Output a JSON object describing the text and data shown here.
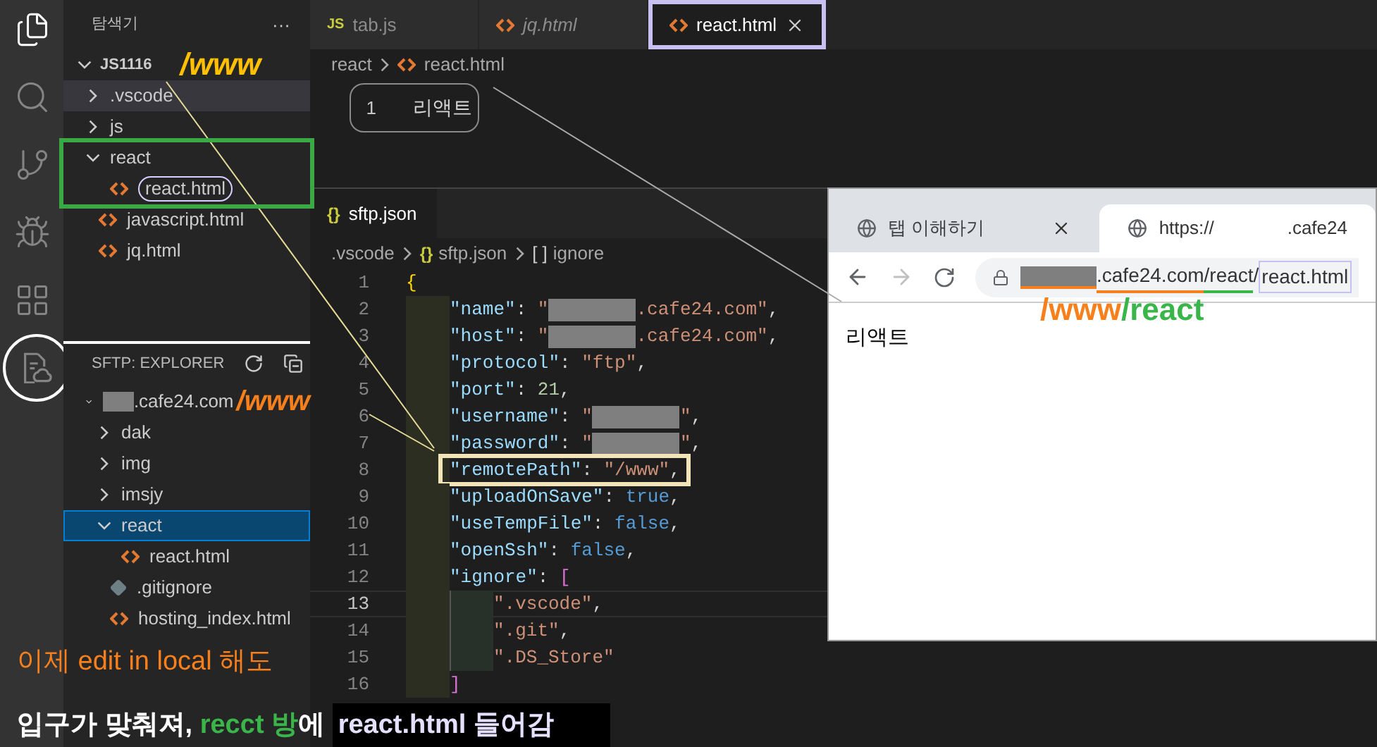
{
  "activity_bar": [
    {
      "kind": "files",
      "selected": true
    },
    {
      "kind": "search",
      "selected": false
    },
    {
      "kind": "source-control",
      "selected": false
    },
    {
      "kind": "run",
      "selected": false
    },
    {
      "kind": "extensions",
      "selected": false
    },
    {
      "kind": "sftp",
      "selected": false,
      "circled": true
    }
  ],
  "explorer": {
    "title": "탐색기",
    "more": "···",
    "root": "JS1116",
    "root_note": "/www",
    "items": [
      {
        "kind": "folder",
        "name": ".vscode",
        "expanded": false,
        "selected": false,
        "hovered": true
      },
      {
        "kind": "folder",
        "name": "js",
        "expanded": false,
        "selected": false
      },
      {
        "kind": "folder",
        "name": "react",
        "expanded": true,
        "selected": false,
        "framed": true,
        "children": [
          {
            "kind": "html",
            "name": "react.html",
            "selected": false,
            "circled": true
          }
        ]
      },
      {
        "kind": "html",
        "name": "javascript.html",
        "selected": false
      },
      {
        "kind": "html",
        "name": "jq.html",
        "selected": false
      }
    ]
  },
  "sftp_explorer": {
    "title": "SFTP: EXPLORER",
    "host": ".cafe24.com",
    "host_note": "/www",
    "items": [
      {
        "kind": "folder",
        "name": "dak",
        "expanded": false,
        "selected": false
      },
      {
        "kind": "folder",
        "name": "img",
        "expanded": false,
        "selected": false
      },
      {
        "kind": "folder",
        "name": "imsjy",
        "expanded": false,
        "selected": false
      },
      {
        "kind": "folder",
        "name": "react",
        "expanded": true,
        "selected": true,
        "children": [
          {
            "kind": "html",
            "name": "react.html",
            "selected": false
          }
        ]
      },
      {
        "kind": "git",
        "name": ".gitignore",
        "selected": false
      },
      {
        "kind": "html",
        "name": "hosting_index.html",
        "selected": false
      }
    ]
  },
  "editor_tabs": [
    {
      "kind": "js",
      "badge": "JS",
      "label": "tab.js",
      "selected": false,
      "preview": false
    },
    {
      "kind": "html",
      "label": "jq.html",
      "selected": false,
      "preview": true
    },
    {
      "kind": "html",
      "label": "react.html",
      "selected": true,
      "preview": false
    }
  ],
  "breadcrumb": [
    {
      "kind": "folder",
      "label": "react"
    },
    {
      "kind": "html",
      "label": "react.html"
    }
  ],
  "lines": [
    {
      "number": "1",
      "text": "리액트"
    }
  ],
  "sftp_editor": {
    "tab": {
      "icon": "{}",
      "label": "sftp.json"
    },
    "breadcrumb": [
      {
        "kind": "folder",
        "label": ".vscode"
      },
      {
        "kind": "json",
        "icon": "{}",
        "label": "sftp.json"
      },
      {
        "kind": "array",
        "icon": "[ ]",
        "label": "ignore"
      }
    ],
    "lines": [
      {
        "number": "1",
        "tokens": [
          {
            "kind": "brace",
            "text": "{"
          }
        ],
        "children": [
          {
            "number": "2",
            "tokens": [
              {
                "kind": "key",
                "text": "\"name\""
              },
              {
                "kind": "punct",
                "text": ": "
              },
              {
                "kind": "string",
                "text": "\""
              },
              {
                "kind": "redacted"
              },
              {
                "kind": "string",
                "text": ".cafe24.com\""
              },
              {
                "kind": "punct",
                "text": ","
              }
            ]
          },
          {
            "number": "3",
            "tokens": [
              {
                "kind": "key",
                "text": "\"host\""
              },
              {
                "kind": "punct",
                "text": ": "
              },
              {
                "kind": "string",
                "text": "\""
              },
              {
                "kind": "redacted"
              },
              {
                "kind": "string",
                "text": ".cafe24.com\""
              },
              {
                "kind": "punct",
                "text": ","
              }
            ]
          },
          {
            "number": "4",
            "tokens": [
              {
                "kind": "key",
                "text": "\"protocol\""
              },
              {
                "kind": "punct",
                "text": ": "
              },
              {
                "kind": "string",
                "text": "\"ftp\""
              },
              {
                "kind": "punct",
                "text": ","
              }
            ]
          },
          {
            "number": "5",
            "tokens": [
              {
                "kind": "key",
                "text": "\"port\""
              },
              {
                "kind": "punct",
                "text": ": "
              },
              {
                "kind": "number",
                "text": "21"
              },
              {
                "kind": "punct",
                "text": ","
              }
            ]
          },
          {
            "number": "6",
            "tokens": [
              {
                "kind": "key",
                "text": "\"username\""
              },
              {
                "kind": "punct",
                "text": ": "
              },
              {
                "kind": "string",
                "text": "\""
              },
              {
                "kind": "redacted"
              },
              {
                "kind": "string",
                "text": "\""
              },
              {
                "kind": "punct",
                "text": ","
              }
            ]
          },
          {
            "number": "7",
            "tokens": [
              {
                "kind": "key",
                "text": "\"password\""
              },
              {
                "kind": "punct",
                "text": ": "
              },
              {
                "kind": "string",
                "text": "\""
              },
              {
                "kind": "redacted"
              },
              {
                "kind": "string",
                "text": "\""
              },
              {
                "kind": "punct",
                "text": ","
              }
            ]
          },
          {
            "number": "8",
            "boxed": true,
            "tokens": [
              {
                "kind": "key",
                "text": "\"remotePath\""
              },
              {
                "kind": "punct",
                "text": ": "
              },
              {
                "kind": "string",
                "text": "\"/www\""
              },
              {
                "kind": "punct",
                "text": ","
              }
            ]
          },
          {
            "number": "9",
            "tokens": [
              {
                "kind": "key",
                "text": "\"uploadOnSave\""
              },
              {
                "kind": "punct",
                "text": ": "
              },
              {
                "kind": "bool",
                "text": "true"
              },
              {
                "kind": "punct",
                "text": ","
              }
            ]
          },
          {
            "number": "10",
            "tokens": [
              {
                "kind": "key",
                "text": "\"useTempFile\""
              },
              {
                "kind": "punct",
                "text": ": "
              },
              {
                "kind": "bool",
                "text": "false"
              },
              {
                "kind": "punct",
                "text": ","
              }
            ]
          },
          {
            "number": "11",
            "tokens": [
              {
                "kind": "key",
                "text": "\"openSsh\""
              },
              {
                "kind": "punct",
                "text": ": "
              },
              {
                "kind": "bool",
                "text": "false"
              },
              {
                "kind": "punct",
                "text": ","
              }
            ]
          },
          {
            "number": "12",
            "tokens": [
              {
                "kind": "key",
                "text": "\"ignore\""
              },
              {
                "kind": "punct",
                "text": ": "
              },
              {
                "kind": "bracket",
                "text": "["
              }
            ],
            "children": [
              {
                "number": "13",
                "current": true,
                "tokens": [
                  {
                    "kind": "string",
                    "text": "\".vscode\""
                  },
                  {
                    "kind": "punct",
                    "text": ","
                  }
                ]
              },
              {
                "number": "14",
                "tokens": [
                  {
                    "kind": "string",
                    "text": "\".git\""
                  },
                  {
                    "kind": "punct",
                    "text": ","
                  }
                ]
              },
              {
                "number": "15",
                "tokens": [
                  {
                    "kind": "string",
                    "text": "\".DS_Store\""
                  }
                ]
              }
            ]
          },
          {
            "number": "16",
            "tokens": [
              {
                "kind": "bracket",
                "text": "]"
              }
            ]
          }
        ]
      }
    ]
  },
  "browser": {
    "tabs": [
      {
        "title": "탭 이해하기",
        "selected": false
      },
      {
        "title": "https://",
        "title_suffix": ".cafe24",
        "selected": true
      }
    ],
    "address": [
      {
        "kind": "redacted",
        "color": "#f7801c"
      },
      {
        "kind": "text",
        "text": ".cafe24.com",
        "color": "#f7801c"
      },
      {
        "kind": "text",
        "text": "/react",
        "color": "#39b54a"
      },
      {
        "kind": "text",
        "text": "/"
      },
      {
        "kind": "boxed",
        "text": "react.html"
      }
    ],
    "address_note": [
      {
        "text": "/www",
        "color": "#f7801c"
      },
      {
        "text": "/react",
        "color": "#39b54a"
      }
    ],
    "page_text": "리액트"
  },
  "notes": [
    {
      "bold": false,
      "segments": [
        {
          "text": "이제 edit in local 해도",
          "color": "#f7801c",
          "boxed": false
        }
      ]
    },
    {
      "bold": true,
      "segments": [
        {
          "text": "입구가 맞춰져, ",
          "color": "#ffffff",
          "boxed": false
        },
        {
          "text": "recct 방",
          "color": "#39b54a",
          "boxed": false
        },
        {
          "text": "에 ",
          "color": "#ffffff",
          "boxed": false
        },
        {
          "text": "react.html 들어감",
          "color": "#e6e0ff",
          "boxed": true
        }
      ]
    }
  ]
}
